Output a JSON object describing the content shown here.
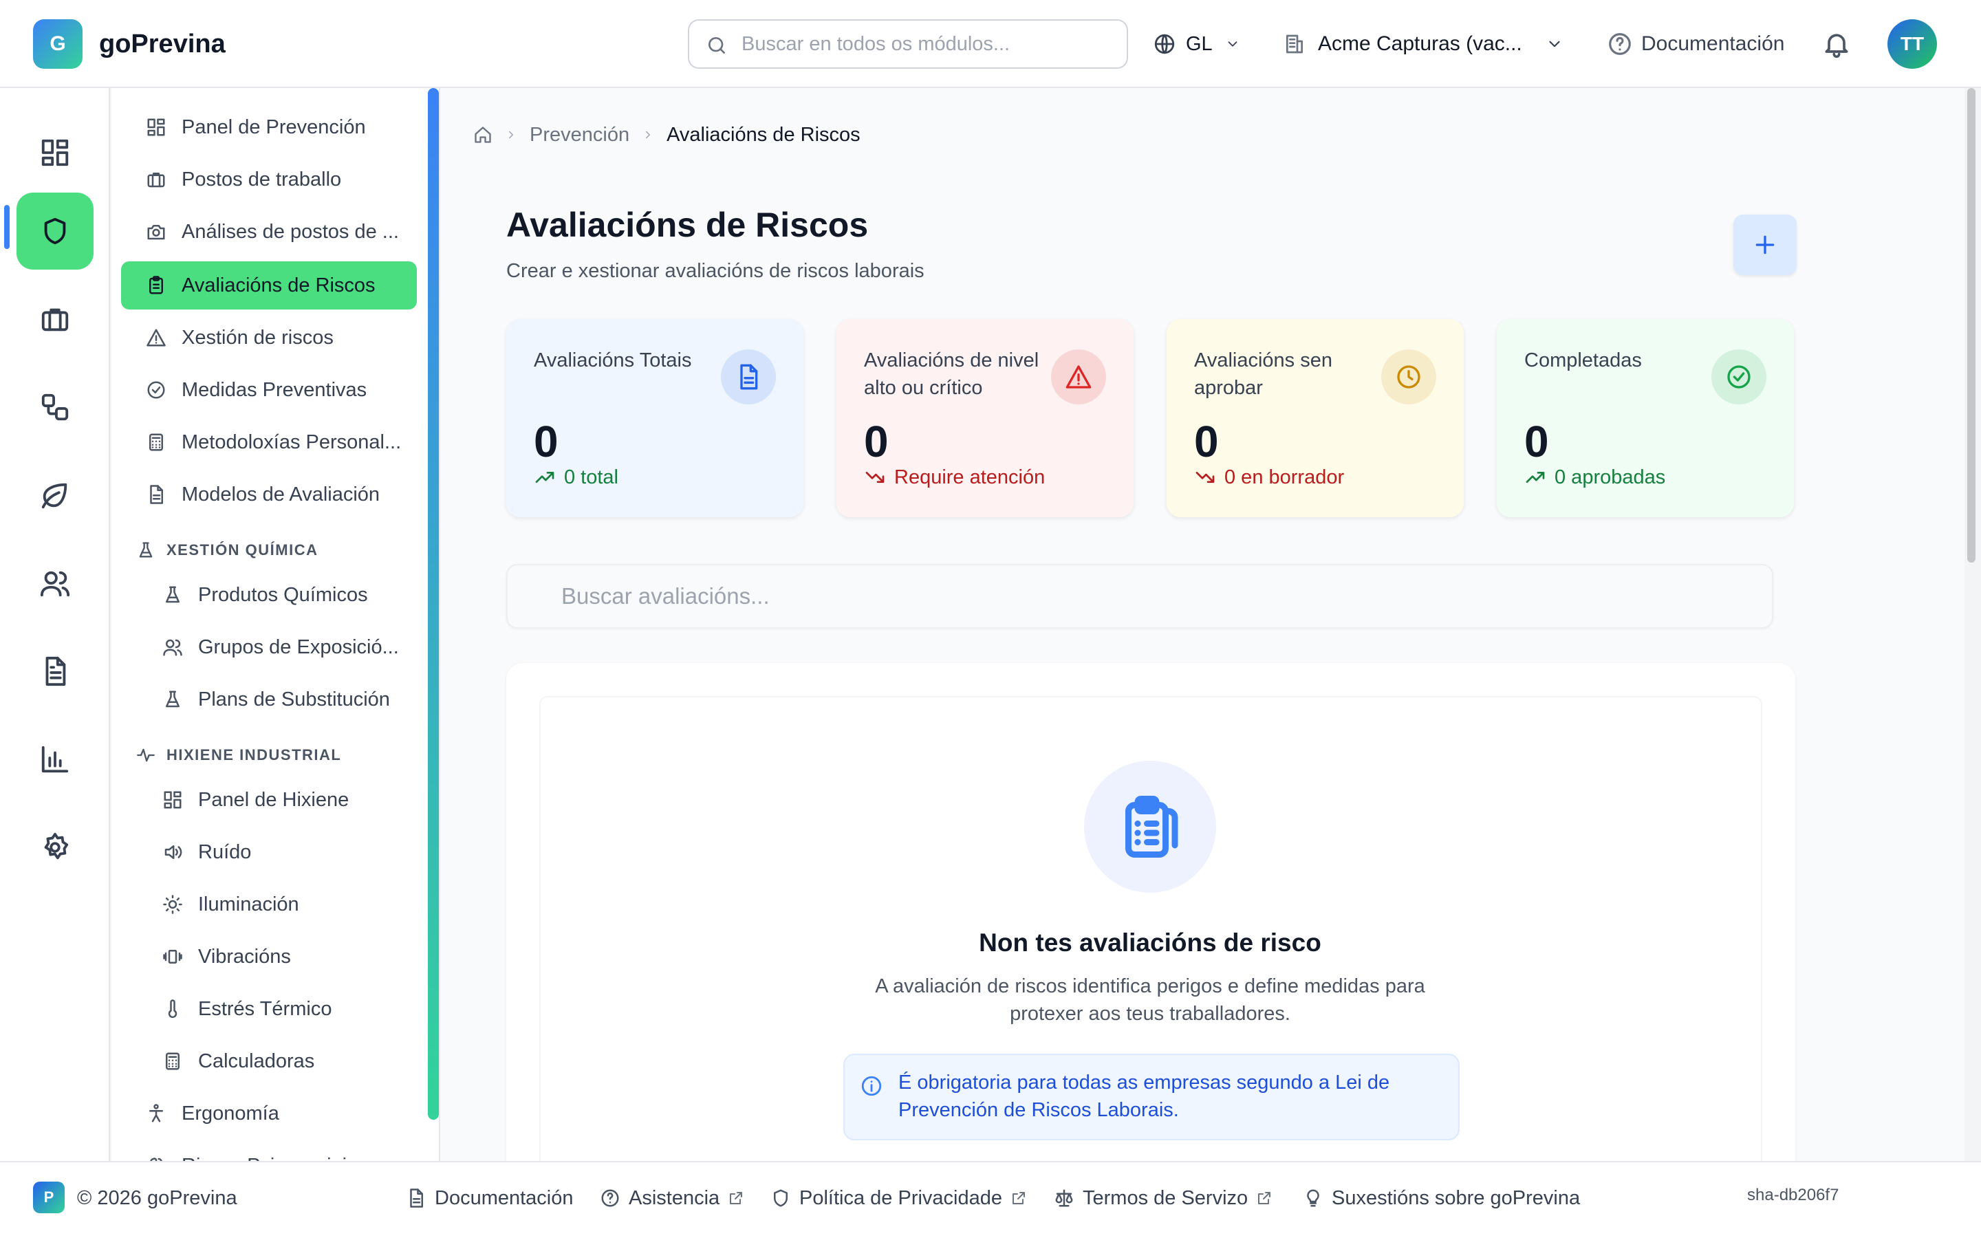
{
  "header": {
    "logo_letter": "G",
    "app_name": "goPrevina",
    "search_placeholder": "Buscar en todos os módulos...",
    "language": "GL",
    "company": "Acme Capturas (vac...",
    "docs_label": "Documentación",
    "avatar_initials": "TT"
  },
  "rail": {
    "items": [
      {
        "icon": "dashboard-icon",
        "active": false
      },
      {
        "icon": "shield-icon",
        "active": true
      },
      {
        "icon": "briefcase-icon",
        "active": false
      },
      {
        "icon": "workflow-icon",
        "active": false
      },
      {
        "icon": "leaf-icon",
        "active": false
      },
      {
        "icon": "users-icon",
        "active": false
      },
      {
        "icon": "document-icon",
        "active": false
      },
      {
        "icon": "chart-icon",
        "active": false
      },
      {
        "icon": "settings-icon",
        "active": false
      }
    ]
  },
  "sidebar": {
    "items": [
      {
        "label": "Panel de Prevención",
        "icon": "dashboard-icon"
      },
      {
        "label": "Postos de traballo",
        "icon": "briefcase-icon"
      },
      {
        "label": "Análises de postos de ...",
        "icon": "camera-icon"
      },
      {
        "label": "Avaliacións de Riscos",
        "icon": "clipboard-icon",
        "active": true
      },
      {
        "label": "Xestión de riscos",
        "icon": "warning-icon"
      },
      {
        "label": "Medidas Preventivas",
        "icon": "check-circle-icon"
      },
      {
        "label": "Metodoloxías Personal...",
        "icon": "calculator-icon"
      },
      {
        "label": "Modelos de Avaliación",
        "icon": "document-icon"
      }
    ],
    "chemical_section": "XESTIÓN QUÍMICA",
    "chemical_items": [
      {
        "label": "Produtos Químicos",
        "icon": "flask-icon"
      },
      {
        "label": "Grupos de Exposició...",
        "icon": "users-icon"
      },
      {
        "label": "Plans de Substitución",
        "icon": "flask-icon"
      }
    ],
    "hygiene_section": "HIXIENE INDUSTRIAL",
    "hygiene_items": [
      {
        "label": "Panel de Hixiene",
        "icon": "dashboard-icon"
      },
      {
        "label": "Ruído",
        "icon": "speaker-icon"
      },
      {
        "label": "Iluminación",
        "icon": "sun-icon"
      },
      {
        "label": "Vibracións",
        "icon": "vibration-icon"
      },
      {
        "label": "Estrés Térmico",
        "icon": "thermometer-icon"
      },
      {
        "label": "Calculadoras",
        "icon": "calculator-icon"
      }
    ],
    "ergonomics": {
      "label": "Ergonomía",
      "icon": "person-icon"
    },
    "cut_item": "Riscos Psicosociais"
  },
  "breadcrumb": {
    "parent": "Prevención",
    "current": "Avaliacións de Riscos"
  },
  "page": {
    "title": "Avaliacións de Riscos",
    "subtitle": "Crear e xestionar avaliacións de riscos laborais"
  },
  "stats": [
    {
      "label": "Avaliacións Totais",
      "value": "0",
      "trend": "0 total",
      "trend_dir": "up",
      "bg": "#eff6ff",
      "accent": "#2563eb",
      "trend_color": "#15803d",
      "icon": "file-icon"
    },
    {
      "label": "Avaliacións de nivel alto ou crítico",
      "value": "0",
      "trend": "Require atención",
      "trend_dir": "down",
      "bg": "#fef2f2",
      "accent": "#dc2626",
      "trend_color": "#b91c1c",
      "icon": "alert-triangle-icon"
    },
    {
      "label": "Avaliacións sen aprobar",
      "value": "0",
      "trend": "0 en borrador",
      "trend_dir": "down",
      "bg": "#fefce8",
      "accent": "#ca8a04",
      "trend_color": "#b91c1c",
      "icon": "clock-icon"
    },
    {
      "label": "Completadas",
      "value": "0",
      "trend": "0 aprobadas",
      "trend_dir": "up",
      "bg": "#f0fdf4",
      "accent": "#16a34a",
      "trend_color": "#15803d",
      "icon": "check-circle-icon"
    }
  ],
  "search_assessments_placeholder": "Buscar avaliacións...",
  "empty_state": {
    "title": "Non tes avaliacións de risco",
    "description": "A avaliación de riscos identifica perigos e define medidas para protexer aos teus traballadores.",
    "info": "É obrigatoria para todas as empresas segundo a Lei de Prevención de Riscos Laborais."
  },
  "footer": {
    "logo_letter": "P",
    "copyright": "© 2026 goPrevina",
    "links": [
      "Documentación",
      "Asistencia",
      "Política de Privacidade",
      "Termos de Servizo",
      "Suxestións sobre goPrevina"
    ],
    "version": "sha-db206f7"
  }
}
